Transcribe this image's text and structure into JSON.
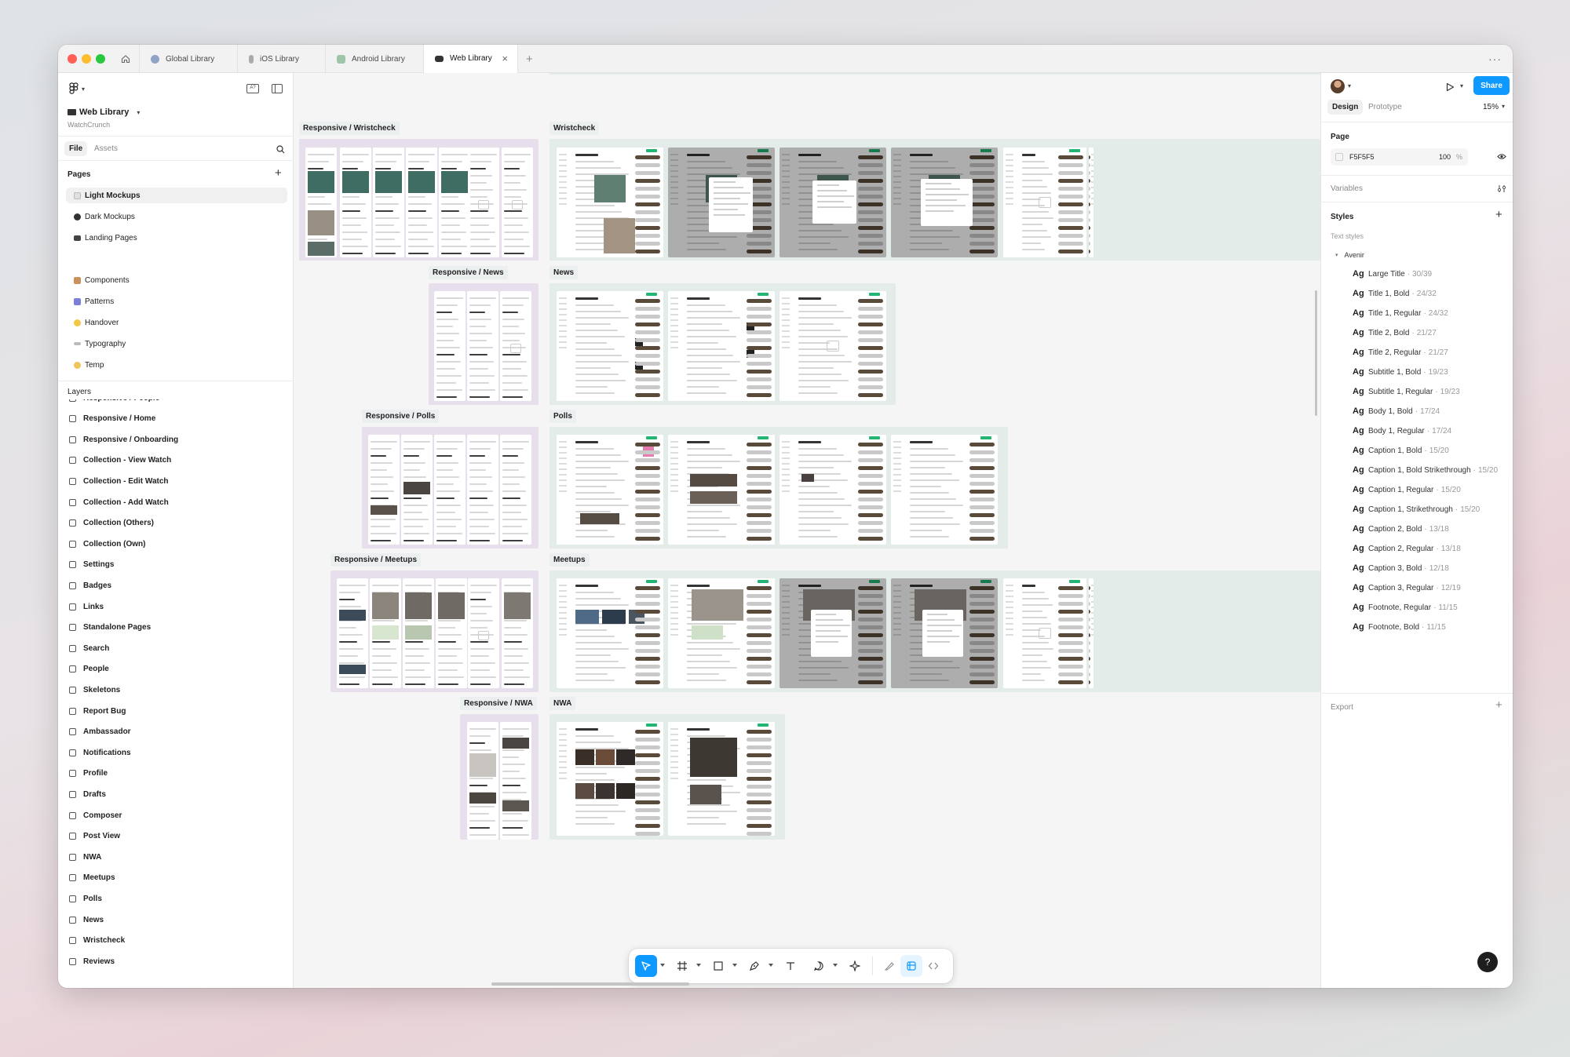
{
  "tabs": [
    {
      "label": "Global Library"
    },
    {
      "label": "iOS Library"
    },
    {
      "label": "Android Library"
    },
    {
      "label": "Web Library"
    }
  ],
  "file": {
    "name": "Web Library",
    "project": "WatchCrunch"
  },
  "panel_tabs": {
    "file": "File",
    "assets": "Assets"
  },
  "pages": {
    "title": "Pages",
    "items": [
      "Light Mockups",
      "Dark Mockups",
      "Landing Pages",
      "Components",
      "Patterns",
      "Handover",
      "Typography",
      "Temp"
    ]
  },
  "layers": {
    "title": "Layers",
    "items": [
      "Responsive / People",
      "Responsive / Home",
      "Responsive / Onboarding",
      "Collection - View Watch",
      "Collection - Edit Watch",
      "Collection - Add Watch",
      "Collection (Others)",
      "Collection (Own)",
      "Settings",
      "Badges",
      "Links",
      "Standalone Pages",
      "Search",
      "People",
      "Skeletons",
      "Report Bug",
      "Ambassador",
      "Notifications",
      "Profile",
      "Drafts",
      "Composer",
      "Post View",
      "NWA",
      "Meetups",
      "Polls",
      "News",
      "Wristcheck",
      "Reviews"
    ]
  },
  "canvas": {
    "frames": [
      "Responsive / Wristcheck",
      "Wristcheck",
      "Responsive / News",
      "News",
      "Responsive / Polls",
      "Polls",
      "Responsive / Meetups",
      "Meetups",
      "Responsive / NWA",
      "NWA"
    ]
  },
  "right_panel": {
    "share": "Share",
    "tab_design": "Design",
    "tab_prototype": "Prototype",
    "zoom": "15%",
    "page_title": "Page",
    "page_color": "F5F5F5",
    "page_opacity": "100",
    "percent": "%",
    "variables": "Variables",
    "styles": "Styles",
    "text_styles": "Text styles",
    "font_group": "Avenir",
    "styles_list": [
      {
        "name": "Large Title",
        "spec": "30/39"
      },
      {
        "name": "Title 1, Bold",
        "spec": "24/32"
      },
      {
        "name": "Title 1, Regular",
        "spec": "24/32"
      },
      {
        "name": "Title 2, Bold",
        "spec": "21/27"
      },
      {
        "name": "Title 2, Regular",
        "spec": "21/27"
      },
      {
        "name": "Subtitle 1, Bold",
        "spec": "19/23"
      },
      {
        "name": "Subtitle 1, Regular",
        "spec": "19/23"
      },
      {
        "name": "Body 1, Bold",
        "spec": "17/24"
      },
      {
        "name": "Body 1, Regular",
        "spec": "17/24"
      },
      {
        "name": "Caption 1, Bold",
        "spec": "15/20"
      },
      {
        "name": "Caption 1, Bold Strikethrough",
        "spec": "15/20"
      },
      {
        "name": "Caption 1, Regular",
        "spec": "15/20"
      },
      {
        "name": "Caption 1, Strikethrough",
        "spec": "15/20"
      },
      {
        "name": "Caption 2, Bold",
        "spec": "13/18"
      },
      {
        "name": "Caption 2, Regular",
        "spec": "13/18"
      },
      {
        "name": "Caption 3, Bold",
        "spec": "12/18"
      },
      {
        "name": "Caption 3, Regular",
        "spec": "12/19"
      },
      {
        "name": "Footnote, Regular",
        "spec": "11/15"
      },
      {
        "name": "Footnote, Bold",
        "spec": "11/15"
      }
    ],
    "ag": "Ag",
    "export": "Export",
    "help": "?"
  },
  "icons": {
    "home": "home-icon",
    "figma": "figma-menu-icon",
    "play": "play-icon",
    "more": "more-icon",
    "search": "search-icon",
    "add": "plus-icon",
    "eye": "eye-icon"
  },
  "colors": {
    "accent": "#0d99ff",
    "mock_green": "#22b573",
    "purple_group": "#e7dfeb",
    "green_group": "#e4ecea"
  }
}
